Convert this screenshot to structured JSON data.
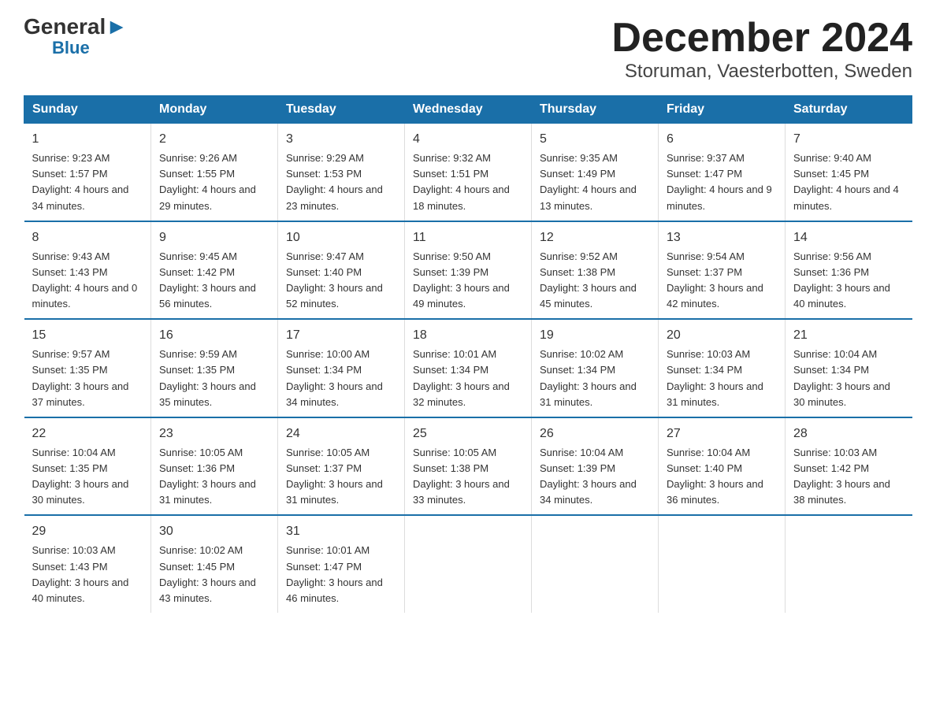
{
  "header": {
    "title": "December 2024",
    "subtitle": "Storuman, Vaesterbotten, Sweden",
    "logo_general": "General",
    "logo_blue": "Blue"
  },
  "weekdays": [
    "Sunday",
    "Monday",
    "Tuesday",
    "Wednesday",
    "Thursday",
    "Friday",
    "Saturday"
  ],
  "weeks": [
    [
      {
        "date": "1",
        "sunrise": "Sunrise: 9:23 AM",
        "sunset": "Sunset: 1:57 PM",
        "daylight": "Daylight: 4 hours and 34 minutes."
      },
      {
        "date": "2",
        "sunrise": "Sunrise: 9:26 AM",
        "sunset": "Sunset: 1:55 PM",
        "daylight": "Daylight: 4 hours and 29 minutes."
      },
      {
        "date": "3",
        "sunrise": "Sunrise: 9:29 AM",
        "sunset": "Sunset: 1:53 PM",
        "daylight": "Daylight: 4 hours and 23 minutes."
      },
      {
        "date": "4",
        "sunrise": "Sunrise: 9:32 AM",
        "sunset": "Sunset: 1:51 PM",
        "daylight": "Daylight: 4 hours and 18 minutes."
      },
      {
        "date": "5",
        "sunrise": "Sunrise: 9:35 AM",
        "sunset": "Sunset: 1:49 PM",
        "daylight": "Daylight: 4 hours and 13 minutes."
      },
      {
        "date": "6",
        "sunrise": "Sunrise: 9:37 AM",
        "sunset": "Sunset: 1:47 PM",
        "daylight": "Daylight: 4 hours and 9 minutes."
      },
      {
        "date": "7",
        "sunrise": "Sunrise: 9:40 AM",
        "sunset": "Sunset: 1:45 PM",
        "daylight": "Daylight: 4 hours and 4 minutes."
      }
    ],
    [
      {
        "date": "8",
        "sunrise": "Sunrise: 9:43 AM",
        "sunset": "Sunset: 1:43 PM",
        "daylight": "Daylight: 4 hours and 0 minutes."
      },
      {
        "date": "9",
        "sunrise": "Sunrise: 9:45 AM",
        "sunset": "Sunset: 1:42 PM",
        "daylight": "Daylight: 3 hours and 56 minutes."
      },
      {
        "date": "10",
        "sunrise": "Sunrise: 9:47 AM",
        "sunset": "Sunset: 1:40 PM",
        "daylight": "Daylight: 3 hours and 52 minutes."
      },
      {
        "date": "11",
        "sunrise": "Sunrise: 9:50 AM",
        "sunset": "Sunset: 1:39 PM",
        "daylight": "Daylight: 3 hours and 49 minutes."
      },
      {
        "date": "12",
        "sunrise": "Sunrise: 9:52 AM",
        "sunset": "Sunset: 1:38 PM",
        "daylight": "Daylight: 3 hours and 45 minutes."
      },
      {
        "date": "13",
        "sunrise": "Sunrise: 9:54 AM",
        "sunset": "Sunset: 1:37 PM",
        "daylight": "Daylight: 3 hours and 42 minutes."
      },
      {
        "date": "14",
        "sunrise": "Sunrise: 9:56 AM",
        "sunset": "Sunset: 1:36 PM",
        "daylight": "Daylight: 3 hours and 40 minutes."
      }
    ],
    [
      {
        "date": "15",
        "sunrise": "Sunrise: 9:57 AM",
        "sunset": "Sunset: 1:35 PM",
        "daylight": "Daylight: 3 hours and 37 minutes."
      },
      {
        "date": "16",
        "sunrise": "Sunrise: 9:59 AM",
        "sunset": "Sunset: 1:35 PM",
        "daylight": "Daylight: 3 hours and 35 minutes."
      },
      {
        "date": "17",
        "sunrise": "Sunrise: 10:00 AM",
        "sunset": "Sunset: 1:34 PM",
        "daylight": "Daylight: 3 hours and 34 minutes."
      },
      {
        "date": "18",
        "sunrise": "Sunrise: 10:01 AM",
        "sunset": "Sunset: 1:34 PM",
        "daylight": "Daylight: 3 hours and 32 minutes."
      },
      {
        "date": "19",
        "sunrise": "Sunrise: 10:02 AM",
        "sunset": "Sunset: 1:34 PM",
        "daylight": "Daylight: 3 hours and 31 minutes."
      },
      {
        "date": "20",
        "sunrise": "Sunrise: 10:03 AM",
        "sunset": "Sunset: 1:34 PM",
        "daylight": "Daylight: 3 hours and 31 minutes."
      },
      {
        "date": "21",
        "sunrise": "Sunrise: 10:04 AM",
        "sunset": "Sunset: 1:34 PM",
        "daylight": "Daylight: 3 hours and 30 minutes."
      }
    ],
    [
      {
        "date": "22",
        "sunrise": "Sunrise: 10:04 AM",
        "sunset": "Sunset: 1:35 PM",
        "daylight": "Daylight: 3 hours and 30 minutes."
      },
      {
        "date": "23",
        "sunrise": "Sunrise: 10:05 AM",
        "sunset": "Sunset: 1:36 PM",
        "daylight": "Daylight: 3 hours and 31 minutes."
      },
      {
        "date": "24",
        "sunrise": "Sunrise: 10:05 AM",
        "sunset": "Sunset: 1:37 PM",
        "daylight": "Daylight: 3 hours and 31 minutes."
      },
      {
        "date": "25",
        "sunrise": "Sunrise: 10:05 AM",
        "sunset": "Sunset: 1:38 PM",
        "daylight": "Daylight: 3 hours and 33 minutes."
      },
      {
        "date": "26",
        "sunrise": "Sunrise: 10:04 AM",
        "sunset": "Sunset: 1:39 PM",
        "daylight": "Daylight: 3 hours and 34 minutes."
      },
      {
        "date": "27",
        "sunrise": "Sunrise: 10:04 AM",
        "sunset": "Sunset: 1:40 PM",
        "daylight": "Daylight: 3 hours and 36 minutes."
      },
      {
        "date": "28",
        "sunrise": "Sunrise: 10:03 AM",
        "sunset": "Sunset: 1:42 PM",
        "daylight": "Daylight: 3 hours and 38 minutes."
      }
    ],
    [
      {
        "date": "29",
        "sunrise": "Sunrise: 10:03 AM",
        "sunset": "Sunset: 1:43 PM",
        "daylight": "Daylight: 3 hours and 40 minutes."
      },
      {
        "date": "30",
        "sunrise": "Sunrise: 10:02 AM",
        "sunset": "Sunset: 1:45 PM",
        "daylight": "Daylight: 3 hours and 43 minutes."
      },
      {
        "date": "31",
        "sunrise": "Sunrise: 10:01 AM",
        "sunset": "Sunset: 1:47 PM",
        "daylight": "Daylight: 3 hours and 46 minutes."
      },
      {
        "date": "",
        "sunrise": "",
        "sunset": "",
        "daylight": ""
      },
      {
        "date": "",
        "sunrise": "",
        "sunset": "",
        "daylight": ""
      },
      {
        "date": "",
        "sunrise": "",
        "sunset": "",
        "daylight": ""
      },
      {
        "date": "",
        "sunrise": "",
        "sunset": "",
        "daylight": ""
      }
    ]
  ]
}
